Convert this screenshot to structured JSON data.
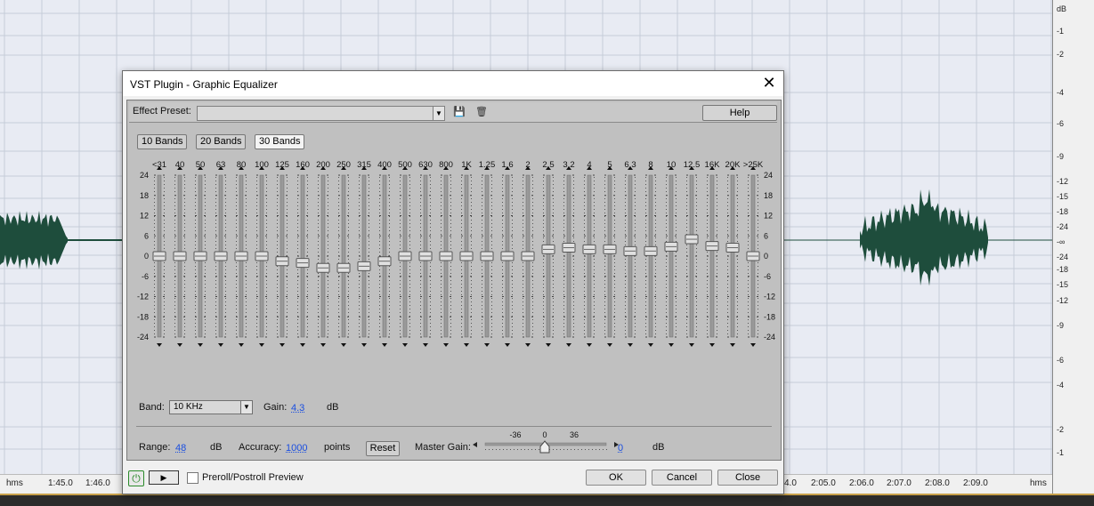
{
  "colors": {
    "waveform": "#1e4d3c",
    "grid_bg": "#e8ebf3",
    "grid_line": "#c6ccd8",
    "dialog_body": "#c0c0c0",
    "link": "#1a4ee0"
  },
  "waveform_view": {
    "db_scale": [
      "dB",
      "-1",
      "-2",
      "-4",
      "-6",
      "-9",
      "-12",
      "-15",
      "-18",
      "-24",
      "-∞",
      "-24",
      "-18",
      "-15",
      "-12",
      "-9",
      "-6",
      "-4",
      "-2",
      "-1"
    ],
    "time_ticks": [
      "hms",
      "1:45.0",
      "1:46.0",
      "4.0",
      "2:05.0",
      "2:06.0",
      "2:07.0",
      "2:08.0",
      "2:09.0",
      "hms"
    ]
  },
  "dialog": {
    "title": "VST Plugin - Graphic Equalizer",
    "close_glyph": "✕",
    "effect_preset_label": "Effect Preset:",
    "effect_preset_value": "",
    "save_icon": "💾",
    "delete_icon": "🗑",
    "help_label": "Help",
    "bands_buttons": [
      "10 Bands",
      "20 Bands",
      "30 Bands"
    ],
    "active_bands": "30 Bands",
    "eq": {
      "frequencies": [
        "<31",
        "40",
        "50",
        "63",
        "80",
        "100",
        "125",
        "160",
        "200",
        "250",
        "315",
        "400",
        "500",
        "630",
        "800",
        "1K",
        "1.25",
        "1.6",
        "2",
        "2.5",
        "3.2",
        "4",
        "5",
        "6.3",
        "8",
        "10",
        "12.5",
        "16K",
        "20K",
        ">25K"
      ],
      "gains_db": [
        0,
        0,
        0,
        0,
        0,
        0,
        -1.5,
        -2,
        -3.5,
        -3.5,
        -3,
        -1.5,
        0,
        0,
        0,
        0,
        0,
        0,
        0,
        2,
        2.5,
        2,
        2,
        1.5,
        1.5,
        2.8,
        5,
        3,
        2.5,
        0
      ],
      "db_scale": [
        "24",
        "18",
        "12",
        "6",
        "0",
        "-6",
        "-12",
        "-18",
        "-24"
      ],
      "range_db": 48
    },
    "band_label": "Band:",
    "band_value": "10 KHz",
    "gain_label": "Gain:",
    "gain_value": "4.3",
    "gain_unit": "dB",
    "range_label": "Range:",
    "range_value": "48",
    "range_unit": "dB",
    "accuracy_label": "Accuracy:",
    "accuracy_value": "1000",
    "accuracy_unit": "points",
    "reset_label": "Reset",
    "master_gain_label": "Master Gain:",
    "master_gain_ticks": [
      "-36",
      "0",
      "36"
    ],
    "master_gain_value": "0",
    "master_gain_unit": "dB",
    "preroll_label": "Preroll/Postroll Preview",
    "ok_label": "OK",
    "cancel_label": "Cancel",
    "close_label": "Close"
  }
}
